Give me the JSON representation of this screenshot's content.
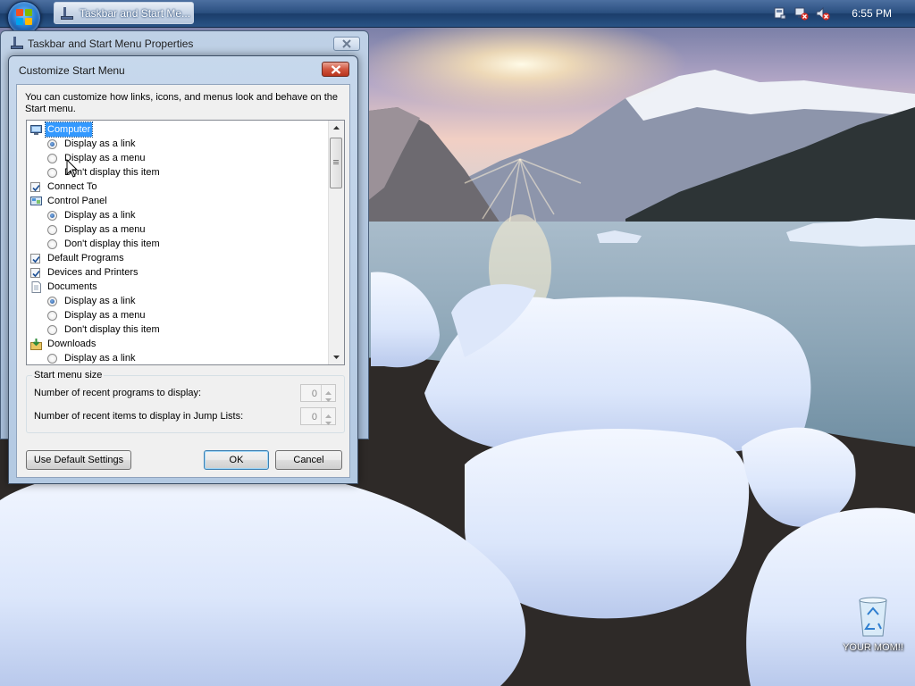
{
  "taskbar": {
    "active_window_label": "Taskbar and Start Me...",
    "clock": "6:55 PM",
    "tray_icons": [
      "action-center-icon",
      "network-disconnected-icon",
      "volume-muted-icon"
    ]
  },
  "props_window": {
    "title": "Taskbar and Start Menu Properties"
  },
  "dialog": {
    "title": "Customize Start Menu",
    "description": "You can customize how links, icons, and menus look and behave on the Start menu.",
    "tree": [
      {
        "type": "header",
        "icon": "computer-icon",
        "label": "Computer",
        "selected": true
      },
      {
        "type": "radio",
        "label": "Display as a link",
        "checked": true
      },
      {
        "type": "radio",
        "label": "Display as a menu",
        "checked": false
      },
      {
        "type": "radio",
        "label": "Don't display this item",
        "checked": false
      },
      {
        "type": "check",
        "label": "Connect To",
        "checked": true
      },
      {
        "type": "header",
        "icon": "control-panel-icon",
        "label": "Control Panel"
      },
      {
        "type": "radio",
        "label": "Display as a link",
        "checked": true
      },
      {
        "type": "radio",
        "label": "Display as a menu",
        "checked": false
      },
      {
        "type": "radio",
        "label": "Don't display this item",
        "checked": false
      },
      {
        "type": "check",
        "label": "Default Programs",
        "checked": true
      },
      {
        "type": "check",
        "label": "Devices and Printers",
        "checked": true
      },
      {
        "type": "header",
        "icon": "documents-icon",
        "label": "Documents"
      },
      {
        "type": "radio",
        "label": "Display as a link",
        "checked": true
      },
      {
        "type": "radio",
        "label": "Display as a menu",
        "checked": false
      },
      {
        "type": "radio",
        "label": "Don't display this item",
        "checked": false
      },
      {
        "type": "header",
        "icon": "downloads-icon",
        "label": "Downloads"
      },
      {
        "type": "radio",
        "label": "Display as a link",
        "checked": false
      }
    ],
    "start_menu_size": {
      "legend": "Start menu size",
      "recent_programs_label": "Number of recent programs to display:",
      "recent_programs_value": "0",
      "recent_items_label": "Number of recent items to display in Jump Lists:",
      "recent_items_value": "0"
    },
    "buttons": {
      "default_settings": "Use Default Settings",
      "ok": "OK",
      "cancel": "Cancel"
    }
  },
  "desktop": {
    "recycle_bin_label": "YOUR MOM!!"
  },
  "colors": {
    "selection": "#3399ff",
    "taskbar": "#2a4f80",
    "dialog_frame": "#b3c9e2",
    "close_button": "#d1563f"
  }
}
